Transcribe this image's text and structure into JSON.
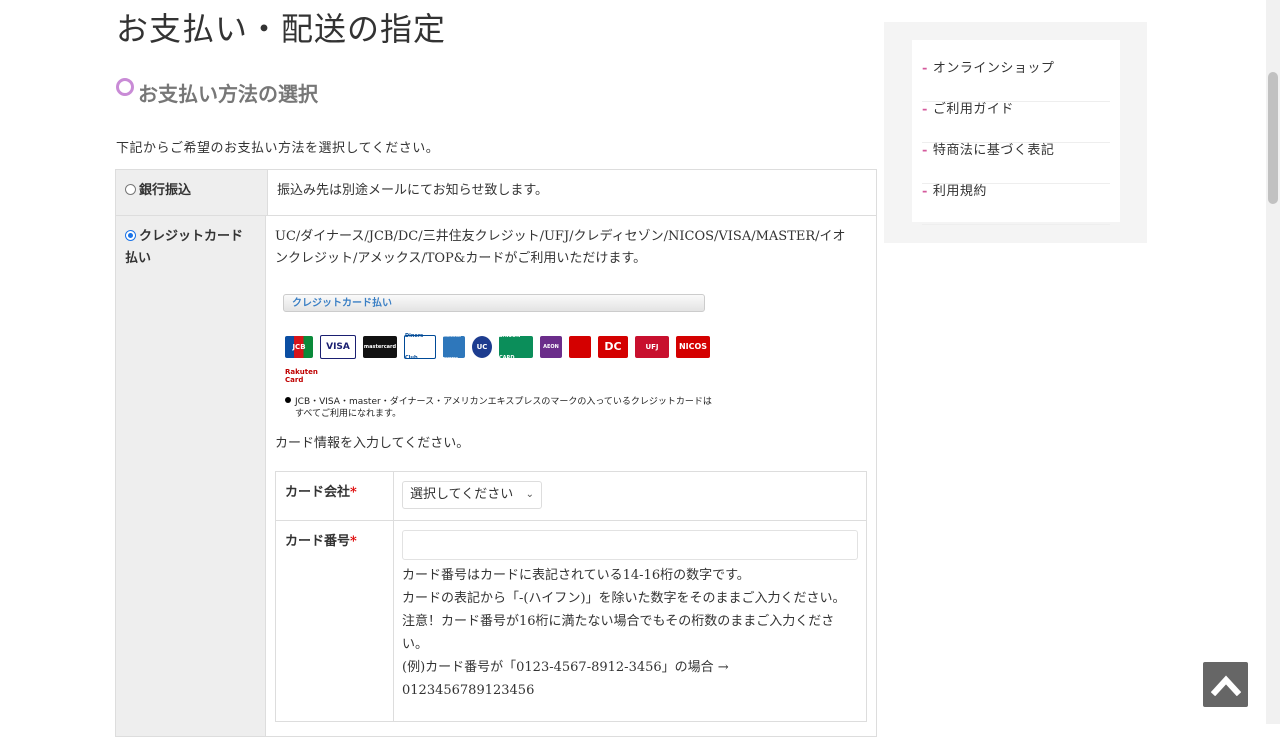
{
  "page_title": "お支払い・配送の指定",
  "section_title": "お支払い方法の選択",
  "intro": "下記からご希望のお支払い方法を選択してください。",
  "payment_methods": [
    {
      "label": "銀行振込",
      "selected": false,
      "description": "振込み先は別途メールにてお知らせ致します。"
    },
    {
      "label": "クレジットカード払い",
      "selected": true,
      "description": "UC/ダイナース/JCB/DC/三井住友クレジット/UFJ/クレディセゾン/NICOS/VISA/MASTER/イオンクレジット/アメックス/TOP&カードがご利用いただけます。"
    }
  ],
  "card_banner": "クレジットカード払い",
  "card_logos": [
    "JCB",
    "VISA",
    "mastercard",
    "Diners Club",
    "AMERICAN EXPRESS",
    "UC",
    "SAISON CARD",
    "AEON",
    "DC",
    "UFJ",
    "NICOS"
  ],
  "rakuten_logo": "Rakuten Card",
  "card_notice_1": "JCB・VISA・master・ダイナース・アメリカンエキスプレスのマークの入っているクレジットカードは",
  "card_notice_2": "すべてご利用になれます。",
  "enter_card_info": "カード情報を入力してください。",
  "form": {
    "card_company_label": "カード会社",
    "card_company_value": "選択してください",
    "card_number_label": "カード番号",
    "required_mark": "*",
    "card_number_value": "",
    "help_1": "カード番号はカードに表記されている14-16桁の数字です。",
    "help_2": "カードの表記から「-(ハイフン)」を除いた数字をそのままご入力ください。",
    "help_3": "注意！カード番号が16桁に満たない場合でもその桁数のままご入力ください。",
    "help_4": "(例)カード番号が「0123-4567-8912-3456」の場合 →",
    "help_5": "0123456789123456"
  },
  "sidebar": {
    "items": [
      {
        "label": "オンラインショップ"
      },
      {
        "label": "ご利用ガイド"
      },
      {
        "label": "特商法に基づく表記"
      },
      {
        "label": "利用規約"
      }
    ]
  },
  "colors": {
    "accent": "#d45a9c",
    "circle": "#c98bd6",
    "required": "#dd0000"
  },
  "icons": {
    "to_top": "chevron-up-icon"
  }
}
